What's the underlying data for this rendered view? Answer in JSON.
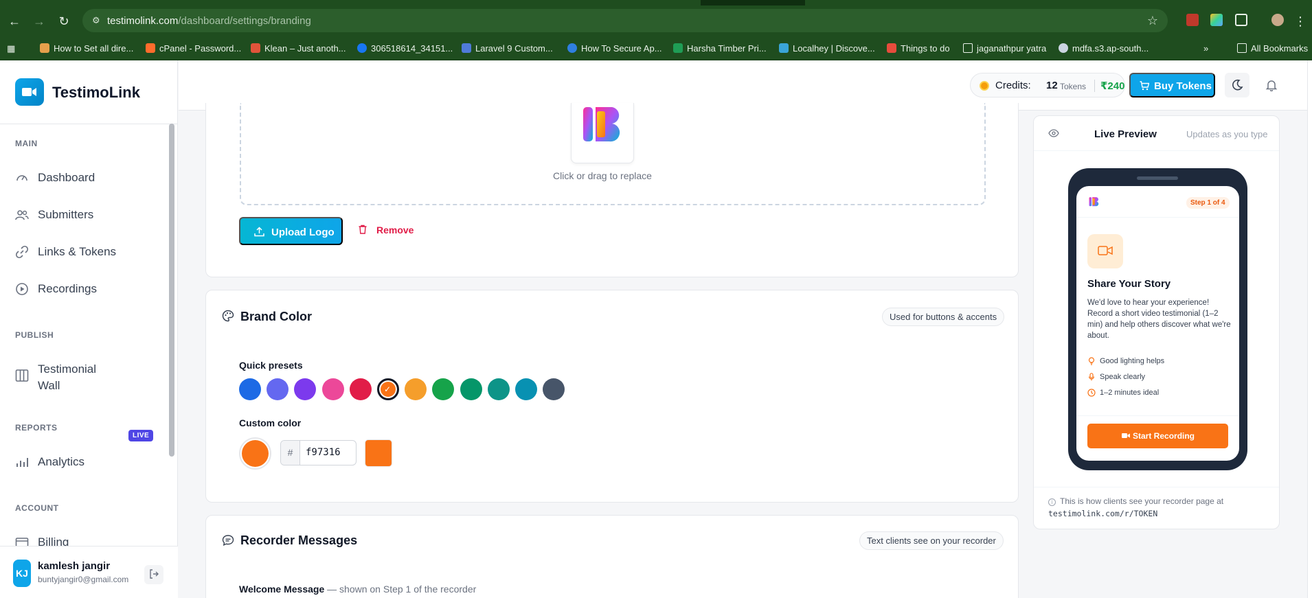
{
  "browser": {
    "url_host": "testimolink.com",
    "url_path": "/dashboard/settings/branding",
    "bookmarks": [
      {
        "label": "How to Set all dire...",
        "color": "#e5a04b"
      },
      {
        "label": "cPanel - Password...",
        "color": "#ff6c2c"
      },
      {
        "label": "Klean – Just anoth...",
        "color": "#e0543a"
      },
      {
        "label": "306518614_34151...",
        "color": "#1877f2"
      },
      {
        "label": "Laravel 9 Custom...",
        "color": "#4f7bd9"
      },
      {
        "label": "How To Secure Ap...",
        "color": "#2f7fe0"
      },
      {
        "label": "Harsha Timber Pri...",
        "color": "#1f9d55"
      },
      {
        "label": "Localhey | Discove...",
        "color": "#3aa5d8"
      },
      {
        "label": "Things to do",
        "color": "#e74c3c"
      },
      {
        "label": "jaganathpur yatra",
        "color": "folder"
      },
      {
        "label": "mdfa.s3.ap-south...",
        "color": "#cbd5e1"
      }
    ],
    "all_bookmarks": "All Bookmarks"
  },
  "app": {
    "name": "TestimoLink"
  },
  "sidebar": {
    "sections": {
      "main": "MAIN",
      "publish": "PUBLISH",
      "reports": "REPORTS",
      "account": "ACCOUNT"
    },
    "items": {
      "dashboard": "Dashboard",
      "submitters": "Submitters",
      "links": "Links & Tokens",
      "recordings": "Recordings",
      "wall_line1": "Testimonial",
      "wall_line2": "Wall",
      "wall_badge": "LIVE",
      "analytics": "Analytics",
      "billing": "Billing"
    },
    "user": {
      "initials": "KJ",
      "name": "kamlesh jangir",
      "email": "buntyjangir0@gmail.com"
    }
  },
  "topbar": {
    "credits_label": "Credits:",
    "credits_value": "12",
    "credits_unit": "Tokens",
    "credits_price": "₹240",
    "buy_label": "Buy Tokens"
  },
  "logo_section": {
    "drop_hint": "Click or drag to replace",
    "upload_label": "Upload Logo",
    "remove_label": "Remove"
  },
  "brand_color": {
    "title": "Brand Color",
    "pill": "Used for buttons & accents",
    "presets_label": "Quick presets",
    "presets": [
      "#1d6ae5",
      "#6468f0",
      "#7c3aed",
      "#ec4899",
      "#e11d48",
      "#f97316",
      "#f59e2b",
      "#16a34a",
      "#059669",
      "#0d9488",
      "#0891b2",
      "#475569"
    ],
    "selected_index": 5,
    "custom_label": "Custom color",
    "hex_prefix": "#",
    "hex_value": "f97316",
    "current_color": "#f97316"
  },
  "recorder_messages": {
    "title": "Recorder Messages",
    "pill": "Text clients see on your recorder",
    "welcome_label": "Welcome Message",
    "welcome_hint": " — shown on Step 1 of the recorder"
  },
  "preview": {
    "title": "Live Preview",
    "subtitle": "Updates as you type",
    "step_badge": "Step 1 of 4",
    "heading": "Share Your Story",
    "body": "We'd love to hear your experience! Record a short video testimonial (1–2 min) and help others discover what we're about.",
    "tips": [
      "Good lighting helps",
      "Speak clearly",
      "1–2 minutes ideal"
    ],
    "start_label": "Start Recording",
    "note": "This is how clients see your recorder page at",
    "url": "testimolink.com/r/TOKEN"
  }
}
